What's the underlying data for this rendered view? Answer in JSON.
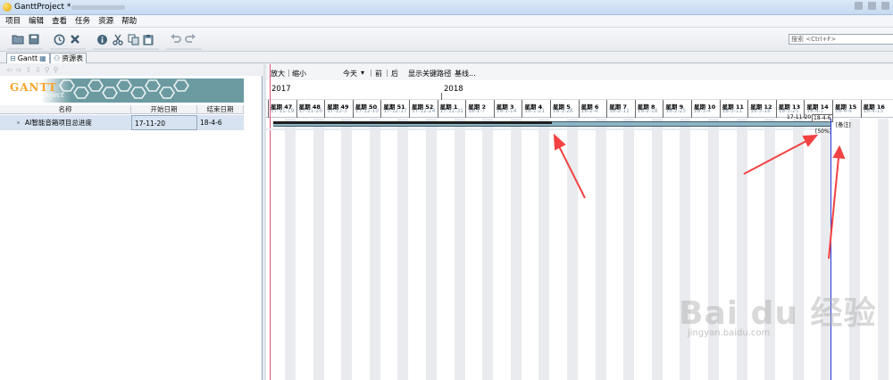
{
  "window": {
    "title": "GanttProject *"
  },
  "menu": [
    "项目",
    "编辑",
    "查看",
    "任务",
    "资源",
    "帮助"
  ],
  "toolbar": {
    "icons": [
      "open-project-icon",
      "save-icon",
      "history-icon",
      "delete-icon",
      "properties-icon",
      "cut-icon",
      "copy-icon",
      "paste-icon",
      "undo-icon",
      "redo-icon"
    ]
  },
  "search": {
    "placeholder": "搜索 <Ctrl+F>"
  },
  "tabs": [
    {
      "label": "Gantt",
      "active": true
    },
    {
      "label": "资源表",
      "active": false
    }
  ],
  "logo": {
    "brand": "GANTT",
    "sub": "project"
  },
  "table": {
    "headers": [
      "名称",
      "开始日期",
      "结束日期"
    ],
    "rows": [
      {
        "name": "AI智能音箱项目总进度",
        "start": "17-11-20",
        "end": "18-4-6"
      }
    ]
  },
  "gantt_toolbar": {
    "zoom_in": "放大",
    "zoom_out": "缩小",
    "today": "今天",
    "prev": "前",
    "next": "后",
    "critical_path": "显示关键路径",
    "baseline": "基线..."
  },
  "years": [
    "2017",
    "2018"
  ],
  "weeks": [
    {
      "label": "星期 47",
      "date": "17-11-19"
    },
    {
      "label": "星期 48",
      "date": "17-11-26"
    },
    {
      "label": "星期 49",
      "date": "17-12-3"
    },
    {
      "label": "星期 50",
      "date": "17-12-10"
    },
    {
      "label": "星期 51",
      "date": "17-12-17"
    },
    {
      "label": "星期 52",
      "date": "17-12-24"
    },
    {
      "label": "星期 1",
      "date": "17-12-31"
    },
    {
      "label": "星期 2",
      "date": "18-1-7"
    },
    {
      "label": "星期 3",
      "date": "18-1-14"
    },
    {
      "label": "星期 4",
      "date": "18-1-21"
    },
    {
      "label": "星期 5",
      "date": "18-1-28"
    },
    {
      "label": "星期 6",
      "date": "18-2-4"
    },
    {
      "label": "星期 7",
      "date": "18-2-11"
    },
    {
      "label": "星期 8",
      "date": "18-2-18"
    },
    {
      "label": "星期 9",
      "date": "18-2-25"
    },
    {
      "label": "星期 10",
      "date": "18-3-4"
    },
    {
      "label": "星期 11",
      "date": "18-3-11"
    },
    {
      "label": "星期 12",
      "date": "18-3-18"
    },
    {
      "label": "星期 13",
      "date": "18-3-25"
    },
    {
      "label": "星期 14",
      "date": "18-4-1"
    },
    {
      "label": "星期 15",
      "date": "18-4-8"
    },
    {
      "label": "星期 16",
      "date": "18-4-15"
    }
  ],
  "task_bar": {
    "start_label": "17-11-20",
    "end_label": "18-4-6",
    "progress_label": "[50%]",
    "note_label": "[备注]",
    "progress": 0.5
  },
  "watermark": {
    "brand": "Bai du 经验",
    "url": "jingyan.baidu.com"
  }
}
